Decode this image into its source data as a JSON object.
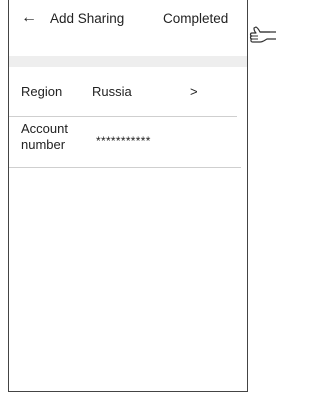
{
  "header": {
    "back_icon": "back-arrow-icon",
    "back_glyph": "←",
    "title": "Add Sharing",
    "complete_label": "Completed"
  },
  "form": {
    "region": {
      "label": "Region",
      "value": "Russia",
      "chevron": ">"
    },
    "account": {
      "label": "Account number",
      "value": "***********"
    }
  },
  "annotation": {
    "pointer_icon": "pointing-hand-icon"
  },
  "colors": {
    "background": "#ffffff",
    "separator": "#eeeeee",
    "divider": "#cfcfcf",
    "text": "#222222"
  }
}
